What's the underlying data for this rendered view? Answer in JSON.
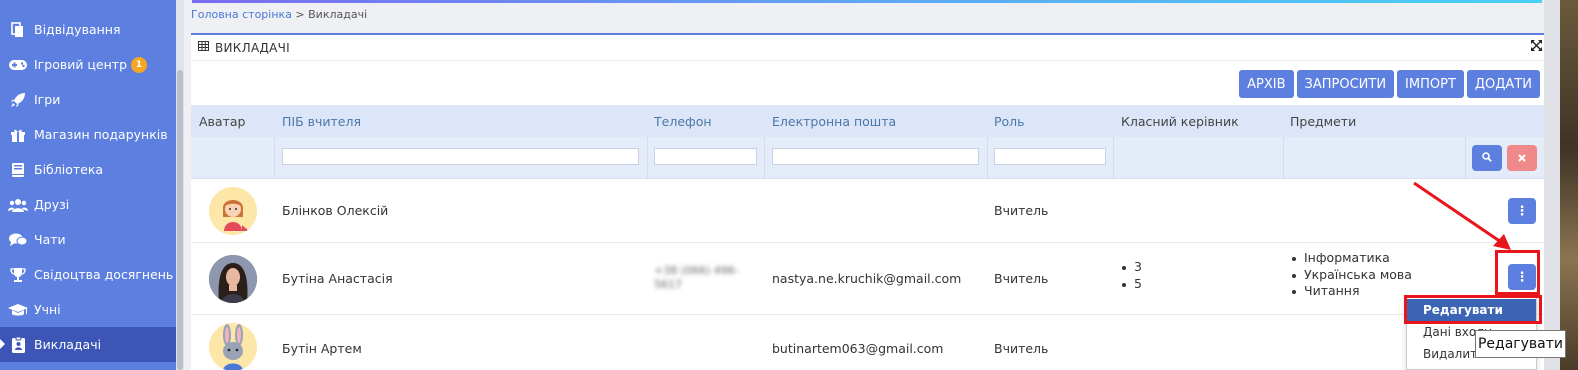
{
  "sidebar": {
    "items": [
      {
        "label": "Відвідування",
        "icon": "file-copy-icon"
      },
      {
        "label": "Ігровий центр",
        "icon": "gamepad-icon",
        "badge": "1"
      },
      {
        "label": "Ігри",
        "icon": "rocket-icon"
      },
      {
        "label": "Магазин подарунків",
        "icon": "gift-icon"
      },
      {
        "label": "Бібліотека",
        "icon": "book-icon"
      },
      {
        "label": "Друзі",
        "icon": "users-icon"
      },
      {
        "label": "Чати",
        "icon": "chat-icon"
      },
      {
        "label": "Свідоцтва досягнень",
        "icon": "trophy-icon"
      },
      {
        "label": "Учні",
        "icon": "graduation-cap-icon"
      },
      {
        "label": "Викладачі",
        "icon": "id-badge-icon",
        "active": true
      }
    ]
  },
  "breadcrumb": {
    "home": "Головна сторінка",
    "separator": " > ",
    "current": "Викладачі"
  },
  "panel": {
    "title": "ВИКЛАДАЧІ"
  },
  "toolbar": {
    "archive": "АРХІВ",
    "invite": "ЗАПРОСИТИ",
    "import": "ІМПОРТ",
    "add": "ДОДАТИ"
  },
  "table": {
    "columns": {
      "avatar": "Аватар",
      "name": "ПІБ вчителя",
      "phone": "Телефон",
      "email": "Електронна пошта",
      "role": "Роль",
      "class_teacher": "Класний керівник",
      "subjects": "Предмети"
    },
    "rows": [
      {
        "name": "Блінков Олексій",
        "phone": "",
        "email": "",
        "role": "Вчитель",
        "classes": [],
        "subjects": []
      },
      {
        "name": "Бутіна Анастасія",
        "phone": "+38 (066) 496-5617",
        "email": "nastya.ne.kruchik@gmail.com",
        "role": "Вчитель",
        "classes": [
          "3",
          "5"
        ],
        "subjects": [
          "Інформатика",
          "Українська мова",
          "Читання"
        ]
      },
      {
        "name": "Бутін Артем",
        "phone": "",
        "email": "butinartem063@gmail.com",
        "role": "Вчитель",
        "classes": [],
        "subjects": []
      }
    ]
  },
  "dropdown": {
    "items": [
      "Редагувати",
      "Дані входу",
      "Видалити"
    ]
  },
  "tooltip": "Редагувати",
  "colors": {
    "accent": "#5d7fe0",
    "sidebar_active": "#3c55b6",
    "highlight_red": "#e8151b",
    "danger_btn": "#f08a8a"
  }
}
